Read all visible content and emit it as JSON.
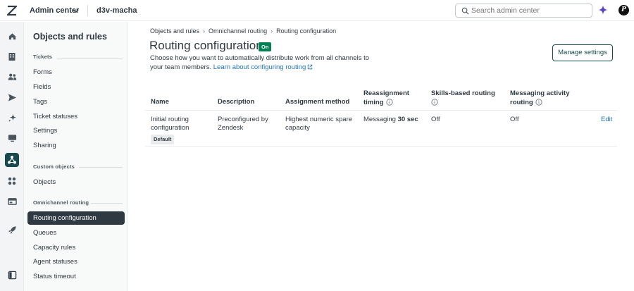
{
  "header": {
    "app_name": "Admin center",
    "account": "d3v-macha",
    "search_placeholder": "Search admin center",
    "avatar_initial": "P"
  },
  "rail_icons": [
    "home-icon",
    "building-icon",
    "people-icon",
    "send-icon",
    "sparkle-icon",
    "monitor-icon",
    "routing-icon",
    "apps-icon",
    "workspace-icon",
    "rocket-icon",
    "sidebar-toggle-icon"
  ],
  "sidenav": {
    "title": "Objects and rules",
    "sections": [
      {
        "label": "Tickets",
        "items": [
          "Forms",
          "Fields",
          "Tags",
          "Ticket statuses",
          "Settings",
          "Sharing"
        ]
      },
      {
        "label": "Custom objects",
        "items": [
          "Objects"
        ]
      },
      {
        "label": "Omnichannel routing",
        "items": [
          "Routing configuration",
          "Queues",
          "Capacity rules",
          "Agent statuses",
          "Status timeout"
        ]
      }
    ],
    "selected": "Routing configuration"
  },
  "breadcrumb": [
    "Objects and rules",
    "Omnichannel routing",
    "Routing configuration"
  ],
  "page": {
    "title": "Routing configuration",
    "status_badge": "On",
    "description": "Choose how you want to automatically distribute work from all channels to your team members.",
    "learn_link": "Learn about configuring routing",
    "manage_button": "Manage settings"
  },
  "table": {
    "headers": {
      "name": "Name",
      "description": "Description",
      "assignment": "Assignment method",
      "reassignment_1": "Reassignment",
      "reassignment_2": "timing",
      "skills": "Skills-based routing",
      "messaging_1": "Messaging activity",
      "messaging_2": "routing"
    },
    "rows": [
      {
        "name_1": "Initial routing",
        "name_2": "configuration",
        "default_badge": "Default",
        "description_1": "Preconfigured by",
        "description_2": "Zendesk",
        "assignment_1": "Highest numeric spare",
        "assignment_2": "capacity",
        "timing_prefix": "Messaging ",
        "timing_value": "30 sec",
        "skills": "Off",
        "messaging": "Off",
        "action": "Edit"
      }
    ]
  },
  "colors": {
    "accent": "#17494d",
    "on_badge": "#038153",
    "link": "#1f73b7",
    "selected_nav": "#2f3941"
  }
}
